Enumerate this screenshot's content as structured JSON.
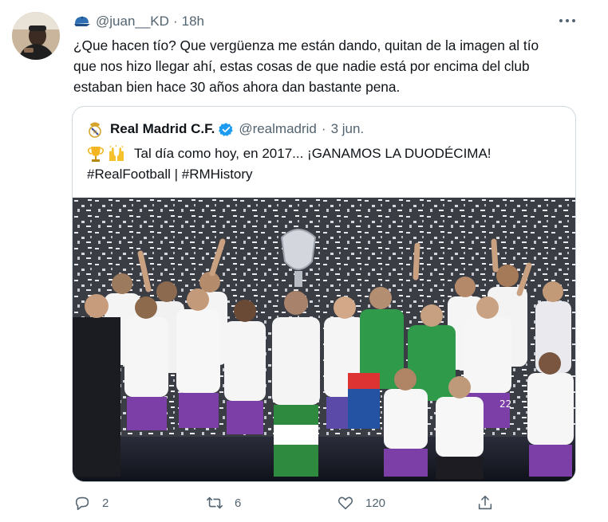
{
  "tweet": {
    "author_handle": "@juan__KD",
    "separator": "·",
    "time": "18h",
    "text_lines": [
      "¿Que hacen tío? Que vergüenza me están dando, quitan de la imagen al tío",
      "que nos hizo llegar ahí, estas cosas de que nadie está por encima del club",
      "estaban bien hace 30 años ahora dan bastante pena."
    ],
    "header_icon": "cap-icon",
    "menu_icon": "more-dots-icon"
  },
  "quote": {
    "name": "Real Madrid C.F.",
    "handle": "@realmadrid",
    "separator": "·",
    "date": "3 jun.",
    "text_line1": "Tal día como hoy, en 2017... ¡GANAMOS LA DUODÉCIMA!",
    "text_line2": "#RealFootball | #RMHistory",
    "emojis": [
      "trophy-icon",
      "raised-hands-icon"
    ],
    "crest_icon": "real-madrid-crest-icon",
    "verified_icon": "verified-badge-icon",
    "photo": "team-celebration-photo"
  },
  "actions": {
    "reply_count": "2",
    "retweet_count": "6",
    "like_count": "120",
    "share_label": ""
  },
  "colors": {
    "text_primary": "#0f1419",
    "text_secondary": "#536471",
    "border": "#cfd9de",
    "verified_blue": "#1d9bf0",
    "kit_purple": "#7c3fa7",
    "keeper_green": "#2f9a4a"
  }
}
